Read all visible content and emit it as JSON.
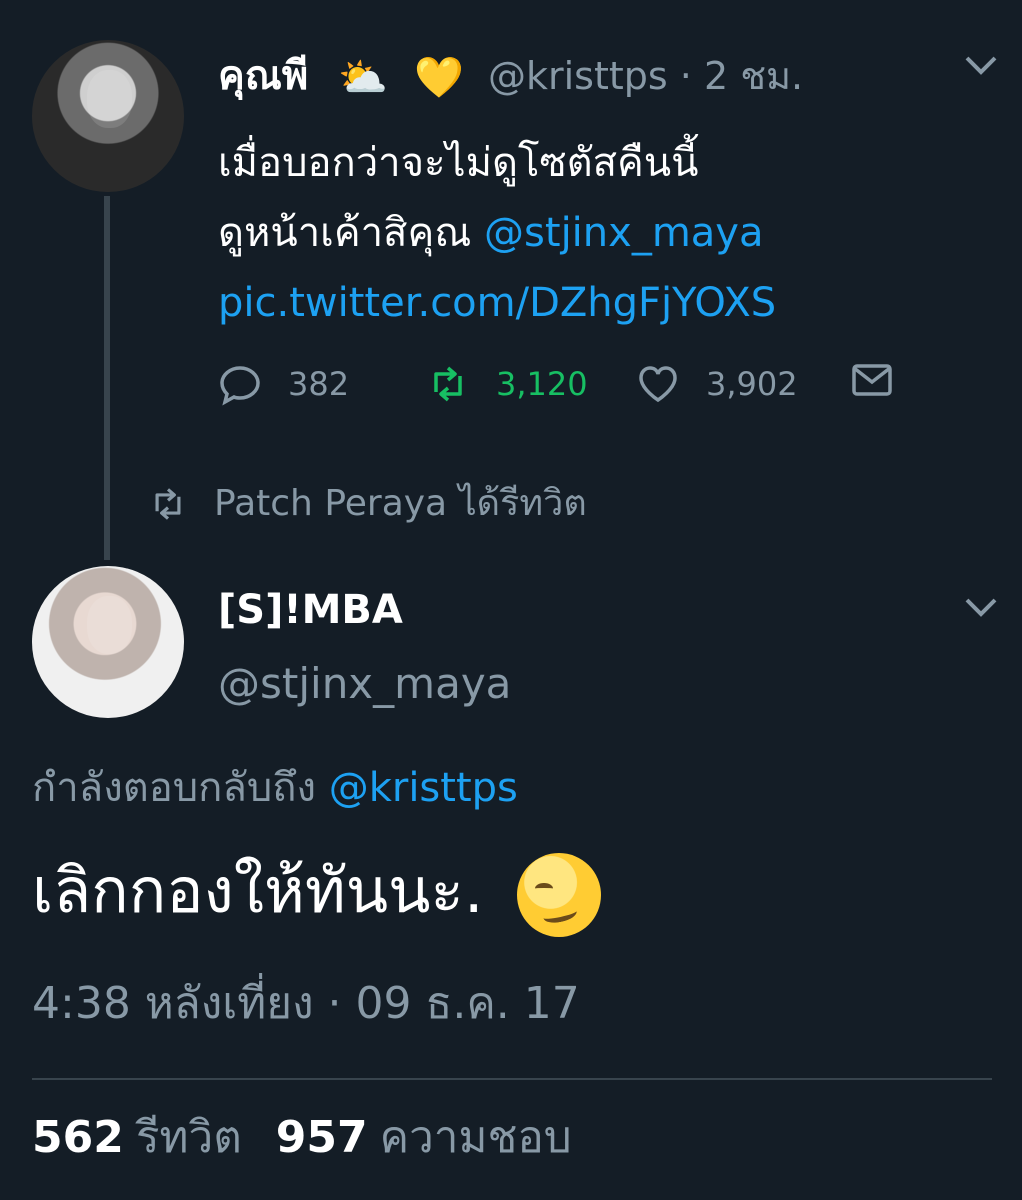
{
  "original_tweet": {
    "display_name": "คุณพี",
    "name_emojis": [
      "⛅",
      "💛"
    ],
    "handle_time": "@kristtps · 2 ชม.",
    "text_line1": "เมื่อบอกว่าจะไม่ดูโซตัสคืนนี้",
    "text_line2_plain": "ดูหน้าเค้าสิคุณ ",
    "mention": "@stjinx_maya",
    "pic_link": "pic.twitter.com/DZhgFjYOXS",
    "actions": {
      "reply_count": "382",
      "retweet_count": "3,120",
      "like_count": "3,902"
    },
    "retweeted_by": "Patch Peraya ได้รีทวิต"
  },
  "reply_tweet": {
    "display_name": "[S]!MBA",
    "handle": "@stjinx_maya",
    "replying_prefix": "กำลังตอบกลับถึง ",
    "replying_to": "@kristtps",
    "text": "เลิกกองให้ทันนะ.",
    "emoji": "smirking-face",
    "timestamp": "4:38 หลังเที่ยง · 09 ธ.ค. 17",
    "retweets_count": "562",
    "retweets_label": "รีทวิต",
    "likes_count": "957",
    "likes_label": "ความชอบ"
  },
  "colors": {
    "background": "#141d26",
    "link": "#1da1f2",
    "secondary_text": "#8899a6",
    "retweet_active": "#17bf63"
  }
}
